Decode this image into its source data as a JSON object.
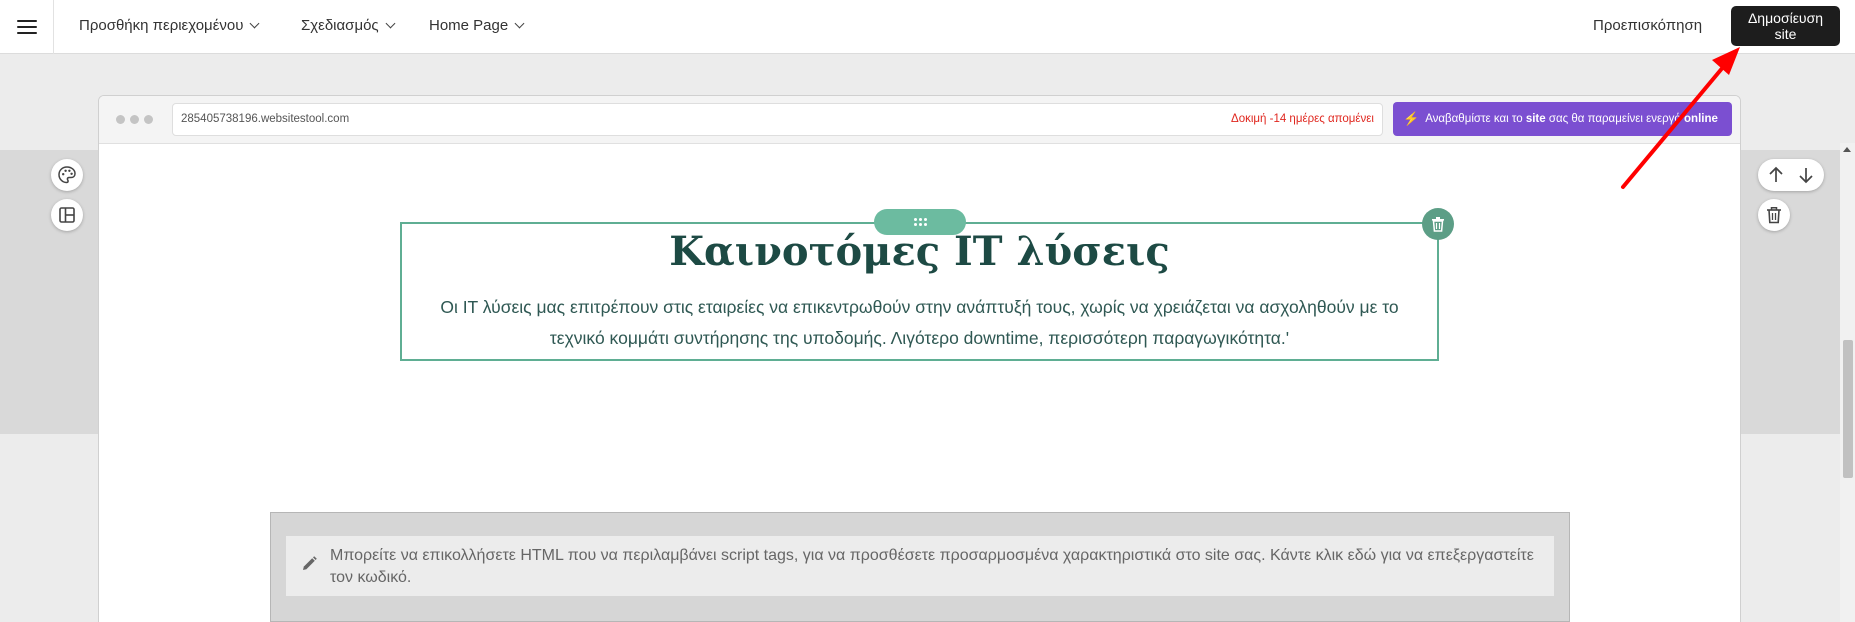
{
  "topbar": {
    "menu_icon": "hamburger-menu-icon",
    "nav": [
      {
        "label": "Προσθήκη περιεχομένου"
      },
      {
        "label": "Σχεδιασμός"
      },
      {
        "label": "Home Page"
      }
    ],
    "preview_label": "Προεπισκόπηση",
    "publish_label": "Δημοσίευση site"
  },
  "browser": {
    "url": "285405738196.websitestool.com",
    "trial_notice": "Δοκιμή -14 ημέρες απομένει",
    "upgrade": {
      "part1": "Αναβαθμίστε και το ",
      "bold1": "site",
      "part2": " σας θα παραμείνει ενεργό ",
      "bold2": "online"
    }
  },
  "content": {
    "headline": "Καινοτόμες IT λύσεις",
    "description": "Οι IT λύσεις μας επιτρέπουν στις εταιρείες να επικεντρωθούν στην ανάπτυξή τους, χωρίς να χρειάζεται να ασχοληθούν με το τεχνικό κομμάτι συντήρησης της υποδομής. Λιγότερο downtime, περισσότερη παραγωγικότητα.'"
  },
  "html_embed": {
    "text": "Μπορείτε να επικολλήσετε HTML που να περιλαμβάνει script tags, για να προσθέσετε προσαρμοσμένα χαρακτηριστικά στο site σας. Κάντε κλικ εδώ για να επεξεργαστείτε τον κωδικό."
  },
  "tools": {
    "left": [
      "palette-icon",
      "layout-icon"
    ],
    "right": [
      "arrow-up-icon",
      "arrow-down-icon",
      "trash-icon"
    ]
  },
  "colors": {
    "accent_green": "#5fae93",
    "upgrade_purple": "#7b4fd1",
    "trial_red": "#e0271f",
    "headline": "#1d4a44",
    "annotation_arrow": "#ff0000"
  }
}
